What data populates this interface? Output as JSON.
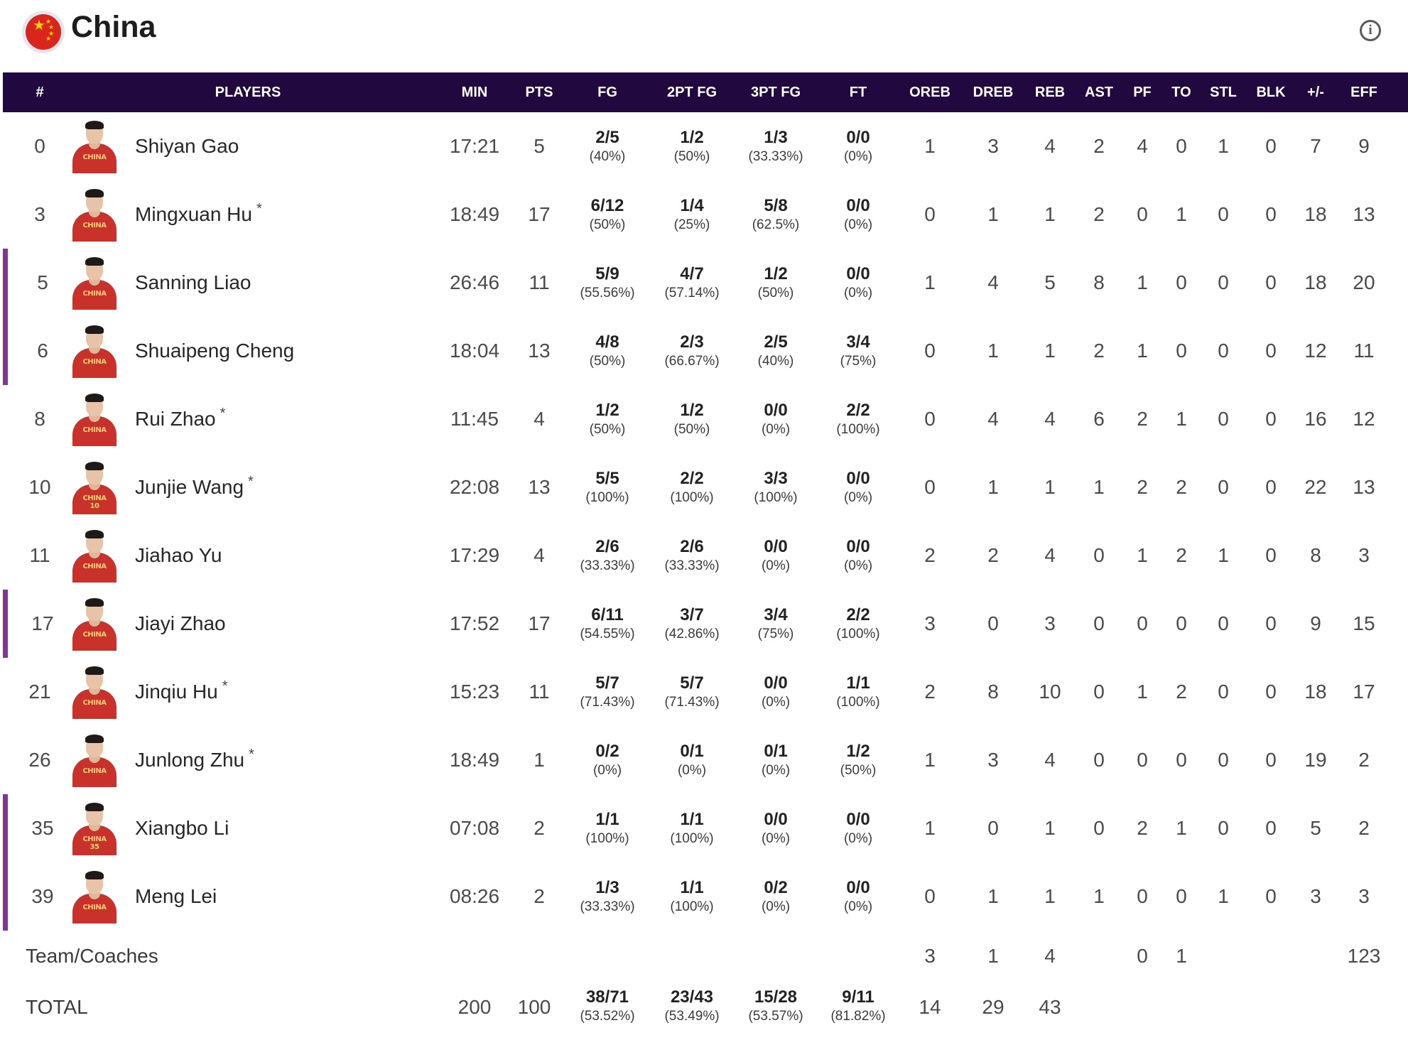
{
  "header": {
    "team_name": "China",
    "flag_icon": "china-flag-icon",
    "info_icon": "info-icon",
    "info_glyph": "i"
  },
  "columns": [
    "#",
    "PLAYERS",
    "MIN",
    "PTS",
    "FG",
    "2PT FG",
    "3PT FG",
    "FT",
    "OREB",
    "DREB",
    "REB",
    "AST",
    "PF",
    "TO",
    "STL",
    "BLK",
    "+/-",
    "EFF"
  ],
  "players": [
    {
      "number": "0",
      "name": "Shiyan Gao",
      "starter": "",
      "min": "17:21",
      "pts": "5",
      "fg": "2/5",
      "fg_pct": "(40%)",
      "fg2": "1/2",
      "fg2_pct": "(50%)",
      "fg3": "1/3",
      "fg3_pct": "(33.33%)",
      "ft": "0/0",
      "ft_pct": "(0%)",
      "oreb": "1",
      "dreb": "3",
      "reb": "4",
      "ast": "2",
      "pf": "4",
      "to": "0",
      "stl": "1",
      "blk": "0",
      "pm": "7",
      "eff": "9",
      "highlight": false,
      "jersey": "CHINA"
    },
    {
      "number": "3",
      "name": "Mingxuan Hu",
      "starter": "*",
      "min": "18:49",
      "pts": "17",
      "fg": "6/12",
      "fg_pct": "(50%)",
      "fg2": "1/4",
      "fg2_pct": "(25%)",
      "fg3": "5/8",
      "fg3_pct": "(62.5%)",
      "ft": "0/0",
      "ft_pct": "(0%)",
      "oreb": "0",
      "dreb": "1",
      "reb": "1",
      "ast": "2",
      "pf": "0",
      "to": "1",
      "stl": "0",
      "blk": "0",
      "pm": "18",
      "eff": "13",
      "highlight": false,
      "jersey": "CHINA"
    },
    {
      "number": "5",
      "name": "Sanning Liao",
      "starter": "",
      "min": "26:46",
      "pts": "11",
      "fg": "5/9",
      "fg_pct": "(55.56%)",
      "fg2": "4/7",
      "fg2_pct": "(57.14%)",
      "fg3": "1/2",
      "fg3_pct": "(50%)",
      "ft": "0/0",
      "ft_pct": "(0%)",
      "oreb": "1",
      "dreb": "4",
      "reb": "5",
      "ast": "8",
      "pf": "1",
      "to": "0",
      "stl": "0",
      "blk": "0",
      "pm": "18",
      "eff": "20",
      "highlight": true,
      "jersey": "CHINA"
    },
    {
      "number": "6",
      "name": "Shuaipeng Cheng",
      "starter": "",
      "min": "18:04",
      "pts": "13",
      "fg": "4/8",
      "fg_pct": "(50%)",
      "fg2": "2/3",
      "fg2_pct": "(66.67%)",
      "fg3": "2/5",
      "fg3_pct": "(40%)",
      "ft": "3/4",
      "ft_pct": "(75%)",
      "oreb": "0",
      "dreb": "1",
      "reb": "1",
      "ast": "2",
      "pf": "1",
      "to": "0",
      "stl": "0",
      "blk": "0",
      "pm": "12",
      "eff": "11",
      "highlight": true,
      "jersey": "CHINA"
    },
    {
      "number": "8",
      "name": "Rui Zhao",
      "starter": "*",
      "min": "11:45",
      "pts": "4",
      "fg": "1/2",
      "fg_pct": "(50%)",
      "fg2": "1/2",
      "fg2_pct": "(50%)",
      "fg3": "0/0",
      "fg3_pct": "(0%)",
      "ft": "2/2",
      "ft_pct": "(100%)",
      "oreb": "0",
      "dreb": "4",
      "reb": "4",
      "ast": "6",
      "pf": "2",
      "to": "1",
      "stl": "0",
      "blk": "0",
      "pm": "16",
      "eff": "12",
      "highlight": false,
      "jersey": "CHINA"
    },
    {
      "number": "10",
      "name": "Junjie Wang",
      "starter": "*",
      "min": "22:08",
      "pts": "13",
      "fg": "5/5",
      "fg_pct": "(100%)",
      "fg2": "2/2",
      "fg2_pct": "(100%)",
      "fg3": "3/3",
      "fg3_pct": "(100%)",
      "ft": "0/0",
      "ft_pct": "(0%)",
      "oreb": "0",
      "dreb": "1",
      "reb": "1",
      "ast": "1",
      "pf": "2",
      "to": "2",
      "stl": "0",
      "blk": "0",
      "pm": "22",
      "eff": "13",
      "highlight": false,
      "jersey": "CHINA 10"
    },
    {
      "number": "11",
      "name": "Jiahao Yu",
      "starter": "",
      "min": "17:29",
      "pts": "4",
      "fg": "2/6",
      "fg_pct": "(33.33%)",
      "fg2": "2/6",
      "fg2_pct": "(33.33%)",
      "fg3": "0/0",
      "fg3_pct": "(0%)",
      "ft": "0/0",
      "ft_pct": "(0%)",
      "oreb": "2",
      "dreb": "2",
      "reb": "4",
      "ast": "0",
      "pf": "1",
      "to": "2",
      "stl": "1",
      "blk": "0",
      "pm": "8",
      "eff": "3",
      "highlight": false,
      "jersey": "CHINA"
    },
    {
      "number": "17",
      "name": "Jiayi Zhao",
      "starter": "",
      "min": "17:52",
      "pts": "17",
      "fg": "6/11",
      "fg_pct": "(54.55%)",
      "fg2": "3/7",
      "fg2_pct": "(42.86%)",
      "fg3": "3/4",
      "fg3_pct": "(75%)",
      "ft": "2/2",
      "ft_pct": "(100%)",
      "oreb": "3",
      "dreb": "0",
      "reb": "3",
      "ast": "0",
      "pf": "0",
      "to": "0",
      "stl": "0",
      "blk": "0",
      "pm": "9",
      "eff": "15",
      "highlight": true,
      "jersey": "CHINA"
    },
    {
      "number": "21",
      "name": "Jinqiu Hu",
      "starter": "*",
      "min": "15:23",
      "pts": "11",
      "fg": "5/7",
      "fg_pct": "(71.43%)",
      "fg2": "5/7",
      "fg2_pct": "(71.43%)",
      "fg3": "0/0",
      "fg3_pct": "(0%)",
      "ft": "1/1",
      "ft_pct": "(100%)",
      "oreb": "2",
      "dreb": "8",
      "reb": "10",
      "ast": "0",
      "pf": "1",
      "to": "2",
      "stl": "0",
      "blk": "0",
      "pm": "18",
      "eff": "17",
      "highlight": false,
      "jersey": "CHINA"
    },
    {
      "number": "26",
      "name": "Junlong Zhu",
      "starter": "*",
      "min": "18:49",
      "pts": "1",
      "fg": "0/2",
      "fg_pct": "(0%)",
      "fg2": "0/1",
      "fg2_pct": "(0%)",
      "fg3": "0/1",
      "fg3_pct": "(0%)",
      "ft": "1/2",
      "ft_pct": "(50%)",
      "oreb": "1",
      "dreb": "3",
      "reb": "4",
      "ast": "0",
      "pf": "0",
      "to": "0",
      "stl": "0",
      "blk": "0",
      "pm": "19",
      "eff": "2",
      "highlight": false,
      "jersey": "CHINA"
    },
    {
      "number": "35",
      "name": "Xiangbo Li",
      "starter": "",
      "min": "07:08",
      "pts": "2",
      "fg": "1/1",
      "fg_pct": "(100%)",
      "fg2": "1/1",
      "fg2_pct": "(100%)",
      "fg3": "0/0",
      "fg3_pct": "(0%)",
      "ft": "0/0",
      "ft_pct": "(0%)",
      "oreb": "1",
      "dreb": "0",
      "reb": "1",
      "ast": "0",
      "pf": "2",
      "to": "1",
      "stl": "0",
      "blk": "0",
      "pm": "5",
      "eff": "2",
      "highlight": true,
      "jersey": "CHINA 35"
    },
    {
      "number": "39",
      "name": "Meng Lei",
      "starter": "",
      "min": "08:26",
      "pts": "2",
      "fg": "1/3",
      "fg_pct": "(33.33%)",
      "fg2": "1/1",
      "fg2_pct": "(100%)",
      "fg3": "0/2",
      "fg3_pct": "(0%)",
      "ft": "0/0",
      "ft_pct": "(0%)",
      "oreb": "0",
      "dreb": "1",
      "reb": "1",
      "ast": "1",
      "pf": "0",
      "to": "0",
      "stl": "1",
      "blk": "0",
      "pm": "3",
      "eff": "3",
      "highlight": true,
      "jersey": "CHINA"
    }
  ],
  "team_row": {
    "label": "Team/Coaches",
    "oreb": "3",
    "dreb": "1",
    "reb": "4",
    "pf": "0",
    "to": "1",
    "eff": "123"
  },
  "total_row": {
    "label": "TOTAL",
    "min": "200",
    "pts": "100",
    "fg": "38/71",
    "fg_pct": "(53.52%)",
    "fg2": "23/43",
    "fg2_pct": "(53.49%)",
    "fg3": "15/28",
    "fg3_pct": "(53.57%)",
    "ft": "9/11",
    "ft_pct": "(81.82%)",
    "oreb": "14",
    "dreb": "29",
    "reb": "43"
  },
  "colors": {
    "header_bg": "#21093f",
    "highlight_bar": "#7b3a8f",
    "flag_red": "#d8261c"
  }
}
